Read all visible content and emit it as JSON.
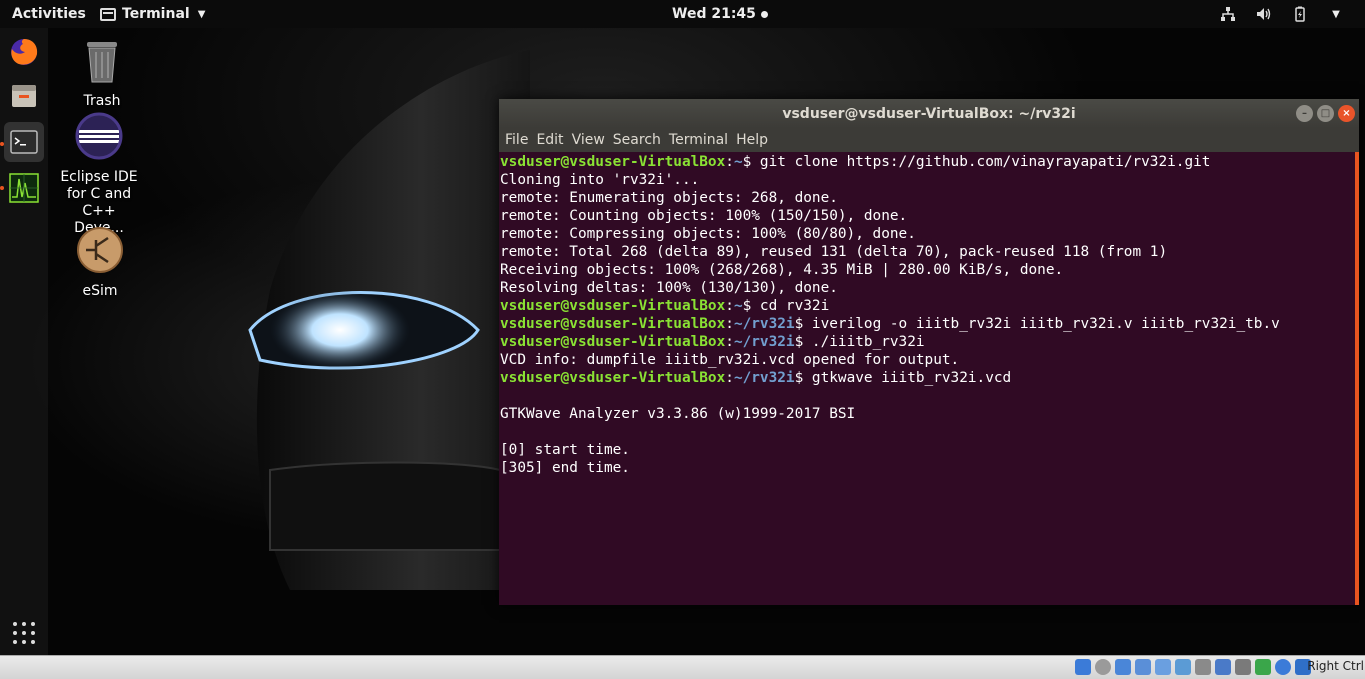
{
  "topbar": {
    "activities": "Activities",
    "app_menu": "Terminal",
    "clock": "Wed 21:45"
  },
  "dock": {
    "items": [
      "Firefox",
      "Files",
      "Terminal",
      "GTKWave"
    ]
  },
  "desktop": {
    "icons": [
      {
        "label": "Trash"
      },
      {
        "label": "Eclipse IDE for C and C++ Deve..."
      },
      {
        "label": "eSim"
      }
    ]
  },
  "terminal": {
    "title": "vsduser@vsduser-VirtualBox: ~/rv32i",
    "menu": [
      "File",
      "Edit",
      "View",
      "Search",
      "Terminal",
      "Help"
    ],
    "lines": [
      {
        "user": "vsduser@vsduser-VirtualBox",
        "path": "~",
        "cmd": "$ git clone https://github.com/vinayrayapati/rv32i.git"
      },
      {
        "text": "Cloning into 'rv32i'..."
      },
      {
        "text": "remote: Enumerating objects: 268, done."
      },
      {
        "text": "remote: Counting objects: 100% (150/150), done."
      },
      {
        "text": "remote: Compressing objects: 100% (80/80), done."
      },
      {
        "text": "remote: Total 268 (delta 89), reused 131 (delta 70), pack-reused 118 (from 1)"
      },
      {
        "text": "Receiving objects: 100% (268/268), 4.35 MiB | 280.00 KiB/s, done."
      },
      {
        "text": "Resolving deltas: 100% (130/130), done."
      },
      {
        "user": "vsduser@vsduser-VirtualBox",
        "path": "~",
        "cmd": "$ cd rv32i"
      },
      {
        "user": "vsduser@vsduser-VirtualBox",
        "path": "~/rv32i",
        "cmd": "$ iverilog -o iiitb_rv32i iiitb_rv32i.v iiitb_rv32i_tb.v"
      },
      {
        "user": "vsduser@vsduser-VirtualBox",
        "path": "~/rv32i",
        "cmd": "$ ./iiitb_rv32i"
      },
      {
        "text": "VCD info: dumpfile iiitb_rv32i.vcd opened for output."
      },
      {
        "user": "vsduser@vsduser-VirtualBox",
        "path": "~/rv32i",
        "cmd": "$ gtkwave iiitb_rv32i.vcd"
      },
      {
        "text": ""
      },
      {
        "text": "GTKWave Analyzer v3.3.86 (w)1999-2017 BSI"
      },
      {
        "text": ""
      },
      {
        "text": "[0] start time."
      },
      {
        "text": "[305] end time."
      }
    ]
  },
  "statusbar": {
    "host_key": "Right Ctrl"
  },
  "colors": {
    "terminal_bg": "#300a24",
    "prompt_user": "#8ae234",
    "prompt_path": "#729fcf",
    "accent": "#e95420"
  }
}
